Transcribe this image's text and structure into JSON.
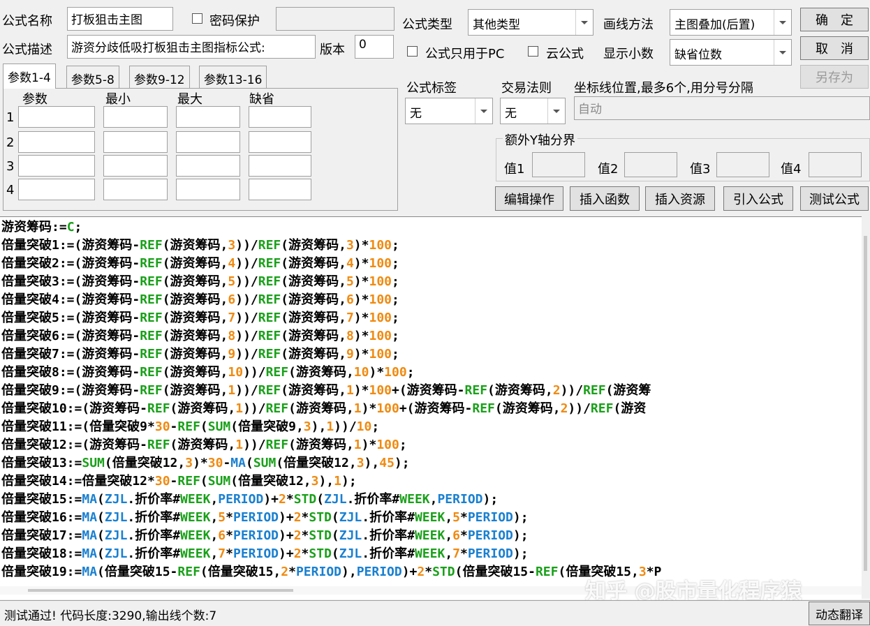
{
  "form": {
    "name_label": "公式名称",
    "name_value": "打板狙击主图",
    "password_label": "密码保护",
    "desc_label": "公式描述",
    "desc_value": "游资分歧低吸打板狙击主图指标公式:",
    "version_label": "版本",
    "version_value": "0",
    "type_label": "公式类型",
    "type_value": "其他类型",
    "draw_label": "画线方法",
    "draw_value": "主图叠加(后置)",
    "pc_only_label": "公式只用于PC",
    "cloud_label": "云公式",
    "decimals_label": "显示小数",
    "decimals_value": "缺省位数",
    "tag_label": "公式标签",
    "tag_value": "无",
    "trade_label": "交易法则",
    "trade_value": "无",
    "axis_label": "坐标线位置,最多6个,用分号分隔",
    "axis_placeholder": "自动",
    "y_group_label": "额外Y轴分界",
    "y_values": [
      "值1",
      "值2",
      "值3",
      "值4"
    ]
  },
  "buttons": {
    "ok": "确　定",
    "cancel": "取　消",
    "save_as": "另存为",
    "edit_ops": "编辑操作",
    "insert_func": "插入函数",
    "insert_res": "插入资源",
    "import_formula": "引入公式",
    "test_formula": "测试公式",
    "dynamic_translate": "动态翻译"
  },
  "params": {
    "tabs": [
      "参数1-4",
      "参数5-8",
      "参数9-12",
      "参数13-16"
    ],
    "headers": [
      "参数",
      "最小",
      "最大",
      "缺省"
    ],
    "rows": [
      "1",
      "2",
      "3",
      "4"
    ]
  },
  "code_lines": [
    [
      [
        "游资筹码:=",
        "t"
      ],
      [
        "C",
        "kw"
      ],
      [
        ";",
        "t"
      ]
    ],
    [
      [
        "倍量突破1:=(游资筹码-",
        "t"
      ],
      [
        "REF",
        "kw"
      ],
      [
        "(游资筹码,",
        "t"
      ],
      [
        "3",
        "num"
      ],
      [
        "))/",
        "t"
      ],
      [
        "REF",
        "kw"
      ],
      [
        "(游资筹码,",
        "t"
      ],
      [
        "3",
        "num"
      ],
      [
        ")*",
        "t"
      ],
      [
        "100",
        "num"
      ],
      [
        ";",
        "t"
      ]
    ],
    [
      [
        "倍量突破2:=(游资筹码-",
        "t"
      ],
      [
        "REF",
        "kw"
      ],
      [
        "(游资筹码,",
        "t"
      ],
      [
        "4",
        "num"
      ],
      [
        "))/",
        "t"
      ],
      [
        "REF",
        "kw"
      ],
      [
        "(游资筹码,",
        "t"
      ],
      [
        "4",
        "num"
      ],
      [
        ")*",
        "t"
      ],
      [
        "100",
        "num"
      ],
      [
        ";",
        "t"
      ]
    ],
    [
      [
        "倍量突破3:=(游资筹码-",
        "t"
      ],
      [
        "REF",
        "kw"
      ],
      [
        "(游资筹码,",
        "t"
      ],
      [
        "5",
        "num"
      ],
      [
        "))/",
        "t"
      ],
      [
        "REF",
        "kw"
      ],
      [
        "(游资筹码,",
        "t"
      ],
      [
        "5",
        "num"
      ],
      [
        ")*",
        "t"
      ],
      [
        "100",
        "num"
      ],
      [
        ";",
        "t"
      ]
    ],
    [
      [
        "倍量突破4:=(游资筹码-",
        "t"
      ],
      [
        "REF",
        "kw"
      ],
      [
        "(游资筹码,",
        "t"
      ],
      [
        "6",
        "num"
      ],
      [
        "))/",
        "t"
      ],
      [
        "REF",
        "kw"
      ],
      [
        "(游资筹码,",
        "t"
      ],
      [
        "6",
        "num"
      ],
      [
        ")*",
        "t"
      ],
      [
        "100",
        "num"
      ],
      [
        ";",
        "t"
      ]
    ],
    [
      [
        "倍量突破5:=(游资筹码-",
        "t"
      ],
      [
        "REF",
        "kw"
      ],
      [
        "(游资筹码,",
        "t"
      ],
      [
        "7",
        "num"
      ],
      [
        "))/",
        "t"
      ],
      [
        "REF",
        "kw"
      ],
      [
        "(游资筹码,",
        "t"
      ],
      [
        "7",
        "num"
      ],
      [
        ")*",
        "t"
      ],
      [
        "100",
        "num"
      ],
      [
        ";",
        "t"
      ]
    ],
    [
      [
        "倍量突破6:=(游资筹码-",
        "t"
      ],
      [
        "REF",
        "kw"
      ],
      [
        "(游资筹码,",
        "t"
      ],
      [
        "8",
        "num"
      ],
      [
        "))/",
        "t"
      ],
      [
        "REF",
        "kw"
      ],
      [
        "(游资筹码,",
        "t"
      ],
      [
        "8",
        "num"
      ],
      [
        ")*",
        "t"
      ],
      [
        "100",
        "num"
      ],
      [
        ";",
        "t"
      ]
    ],
    [
      [
        "倍量突破7:=(游资筹码-",
        "t"
      ],
      [
        "REF",
        "kw"
      ],
      [
        "(游资筹码,",
        "t"
      ],
      [
        "9",
        "num"
      ],
      [
        "))/",
        "t"
      ],
      [
        "REF",
        "kw"
      ],
      [
        "(游资筹码,",
        "t"
      ],
      [
        "9",
        "num"
      ],
      [
        ")*",
        "t"
      ],
      [
        "100",
        "num"
      ],
      [
        ";",
        "t"
      ]
    ],
    [
      [
        "倍量突破8:=(游资筹码-",
        "t"
      ],
      [
        "REF",
        "kw"
      ],
      [
        "(游资筹码,",
        "t"
      ],
      [
        "10",
        "num"
      ],
      [
        "))/",
        "t"
      ],
      [
        "REF",
        "kw"
      ],
      [
        "(游资筹码,",
        "t"
      ],
      [
        "10",
        "num"
      ],
      [
        ")*",
        "t"
      ],
      [
        "100",
        "num"
      ],
      [
        ";",
        "t"
      ]
    ],
    [
      [
        "倍量突破9:=(游资筹码-",
        "t"
      ],
      [
        "REF",
        "kw"
      ],
      [
        "(游资筹码,",
        "t"
      ],
      [
        "1",
        "num"
      ],
      [
        "))/",
        "t"
      ],
      [
        "REF",
        "kw"
      ],
      [
        "(游资筹码,",
        "t"
      ],
      [
        "1",
        "num"
      ],
      [
        ")*",
        "t"
      ],
      [
        "100",
        "num"
      ],
      [
        "+(游资筹码-",
        "t"
      ],
      [
        "REF",
        "kw"
      ],
      [
        "(游资筹码,",
        "t"
      ],
      [
        "2",
        "num"
      ],
      [
        "))/",
        "t"
      ],
      [
        "REF",
        "kw"
      ],
      [
        "(游资筹",
        "t"
      ]
    ],
    [
      [
        "倍量突破10:=(游资筹码-",
        "t"
      ],
      [
        "REF",
        "kw"
      ],
      [
        "(游资筹码,",
        "t"
      ],
      [
        "1",
        "num"
      ],
      [
        "))/",
        "t"
      ],
      [
        "REF",
        "kw"
      ],
      [
        "(游资筹码,",
        "t"
      ],
      [
        "1",
        "num"
      ],
      [
        ")*",
        "t"
      ],
      [
        "100",
        "num"
      ],
      [
        "+(游资筹码-",
        "t"
      ],
      [
        "REF",
        "kw"
      ],
      [
        "(游资筹码,",
        "t"
      ],
      [
        "2",
        "num"
      ],
      [
        "))/",
        "t"
      ],
      [
        "REF",
        "kw"
      ],
      [
        "(游资",
        "t"
      ]
    ],
    [
      [
        "倍量突破11:=(倍量突破9*",
        "t"
      ],
      [
        "30",
        "num"
      ],
      [
        "-",
        "t"
      ],
      [
        "REF",
        "kw"
      ],
      [
        "(",
        "t"
      ],
      [
        "SUM",
        "kw"
      ],
      [
        "(倍量突破9,",
        "t"
      ],
      [
        "3",
        "num"
      ],
      [
        "),",
        "t"
      ],
      [
        "1",
        "num"
      ],
      [
        "))/",
        "t"
      ],
      [
        "10",
        "num"
      ],
      [
        ";",
        "t"
      ]
    ],
    [
      [
        "倍量突破12:=(游资筹码-",
        "t"
      ],
      [
        "REF",
        "kw"
      ],
      [
        "(游资筹码,",
        "t"
      ],
      [
        "1",
        "num"
      ],
      [
        "))/",
        "t"
      ],
      [
        "REF",
        "kw"
      ],
      [
        "(游资筹码,",
        "t"
      ],
      [
        "1",
        "num"
      ],
      [
        ")*",
        "t"
      ],
      [
        "100",
        "num"
      ],
      [
        ";",
        "t"
      ]
    ],
    [
      [
        "倍量突破13:=",
        "t"
      ],
      [
        "SUM",
        "kw"
      ],
      [
        "(倍量突破12,",
        "t"
      ],
      [
        "3",
        "num"
      ],
      [
        ")*",
        "t"
      ],
      [
        "30",
        "num"
      ],
      [
        "-",
        "t"
      ],
      [
        "MA",
        "fn2"
      ],
      [
        "(",
        "t"
      ],
      [
        "SUM",
        "kw"
      ],
      [
        "(倍量突破12,",
        "t"
      ],
      [
        "3",
        "num"
      ],
      [
        "),",
        "t"
      ],
      [
        "45",
        "num"
      ],
      [
        ");",
        "t"
      ]
    ],
    [
      [
        "倍量突破14:=倍量突破12*",
        "t"
      ],
      [
        "30",
        "num"
      ],
      [
        "-",
        "t"
      ],
      [
        "REF",
        "kw"
      ],
      [
        "(",
        "t"
      ],
      [
        "SUM",
        "kw"
      ],
      [
        "(倍量突破12,",
        "t"
      ],
      [
        "3",
        "num"
      ],
      [
        "),",
        "t"
      ],
      [
        "1",
        "num"
      ],
      [
        ");",
        "t"
      ]
    ],
    [
      [
        "倍量突破15:=",
        "t"
      ],
      [
        "MA",
        "fn2"
      ],
      [
        "(",
        "t"
      ],
      [
        "ZJL",
        "fn2"
      ],
      [
        ".折价率#",
        "t"
      ],
      [
        "WEEK",
        "kw"
      ],
      [
        ",",
        "t"
      ],
      [
        "PERIOD",
        "fn2"
      ],
      [
        ")+",
        "t"
      ],
      [
        "2",
        "num"
      ],
      [
        "*",
        "t"
      ],
      [
        "STD",
        "kw"
      ],
      [
        "(",
        "t"
      ],
      [
        "ZJL",
        "fn2"
      ],
      [
        ".折价率#",
        "t"
      ],
      [
        "WEEK",
        "kw"
      ],
      [
        ",",
        "t"
      ],
      [
        "PERIOD",
        "fn2"
      ],
      [
        ");",
        "t"
      ]
    ],
    [
      [
        "倍量突破16:=",
        "t"
      ],
      [
        "MA",
        "fn2"
      ],
      [
        "(",
        "t"
      ],
      [
        "ZJL",
        "fn2"
      ],
      [
        ".折价率#",
        "t"
      ],
      [
        "WEEK",
        "kw"
      ],
      [
        ",",
        "t"
      ],
      [
        "5",
        "num"
      ],
      [
        "*",
        "t"
      ],
      [
        "PERIOD",
        "fn2"
      ],
      [
        ")+",
        "t"
      ],
      [
        "2",
        "num"
      ],
      [
        "*",
        "t"
      ],
      [
        "STD",
        "kw"
      ],
      [
        "(",
        "t"
      ],
      [
        "ZJL",
        "fn2"
      ],
      [
        ".折价率#",
        "t"
      ],
      [
        "WEEK",
        "kw"
      ],
      [
        ",",
        "t"
      ],
      [
        "5",
        "num"
      ],
      [
        "*",
        "t"
      ],
      [
        "PERIOD",
        "fn2"
      ],
      [
        ");",
        "t"
      ]
    ],
    [
      [
        "倍量突破17:=",
        "t"
      ],
      [
        "MA",
        "fn2"
      ],
      [
        "(",
        "t"
      ],
      [
        "ZJL",
        "fn2"
      ],
      [
        ".折价率#",
        "t"
      ],
      [
        "WEEK",
        "kw"
      ],
      [
        ",",
        "t"
      ],
      [
        "6",
        "num"
      ],
      [
        "*",
        "t"
      ],
      [
        "PERIOD",
        "fn2"
      ],
      [
        ")+",
        "t"
      ],
      [
        "2",
        "num"
      ],
      [
        "*",
        "t"
      ],
      [
        "STD",
        "kw"
      ],
      [
        "(",
        "t"
      ],
      [
        "ZJL",
        "fn2"
      ],
      [
        ".折价率#",
        "t"
      ],
      [
        "WEEK",
        "kw"
      ],
      [
        ",",
        "t"
      ],
      [
        "6",
        "num"
      ],
      [
        "*",
        "t"
      ],
      [
        "PERIOD",
        "fn2"
      ],
      [
        ");",
        "t"
      ]
    ],
    [
      [
        "倍量突破18:=",
        "t"
      ],
      [
        "MA",
        "fn2"
      ],
      [
        "(",
        "t"
      ],
      [
        "ZJL",
        "fn2"
      ],
      [
        ".折价率#",
        "t"
      ],
      [
        "WEEK",
        "kw"
      ],
      [
        ",",
        "t"
      ],
      [
        "7",
        "num"
      ],
      [
        "*",
        "t"
      ],
      [
        "PERIOD",
        "fn2"
      ],
      [
        ")+",
        "t"
      ],
      [
        "2",
        "num"
      ],
      [
        "*",
        "t"
      ],
      [
        "STD",
        "kw"
      ],
      [
        "(",
        "t"
      ],
      [
        "ZJL",
        "fn2"
      ],
      [
        ".折价率#",
        "t"
      ],
      [
        "WEEK",
        "kw"
      ],
      [
        ",",
        "t"
      ],
      [
        "7",
        "num"
      ],
      [
        "*",
        "t"
      ],
      [
        "PERIOD",
        "fn2"
      ],
      [
        ");",
        "t"
      ]
    ],
    [
      [
        "倍量突破19:=",
        "t"
      ],
      [
        "MA",
        "fn2"
      ],
      [
        "(倍量突破15-",
        "t"
      ],
      [
        "REF",
        "kw"
      ],
      [
        "(倍量突破15,",
        "t"
      ],
      [
        "2",
        "num"
      ],
      [
        "*",
        "t"
      ],
      [
        "PERIOD",
        "fn2"
      ],
      [
        "),",
        "t"
      ],
      [
        "PERIOD",
        "fn2"
      ],
      [
        ")+",
        "t"
      ],
      [
        "2",
        "num"
      ],
      [
        "*",
        "t"
      ],
      [
        "STD",
        "kw"
      ],
      [
        "(倍量突破15-",
        "t"
      ],
      [
        "REF",
        "kw"
      ],
      [
        "(倍量突破15,",
        "t"
      ],
      [
        "3",
        "num"
      ],
      [
        "*P",
        "t"
      ]
    ]
  ],
  "status": {
    "message": "测试通过! 代码长度:3290,输出线个数:7"
  },
  "watermark": "知乎 @股市量化程序猿"
}
